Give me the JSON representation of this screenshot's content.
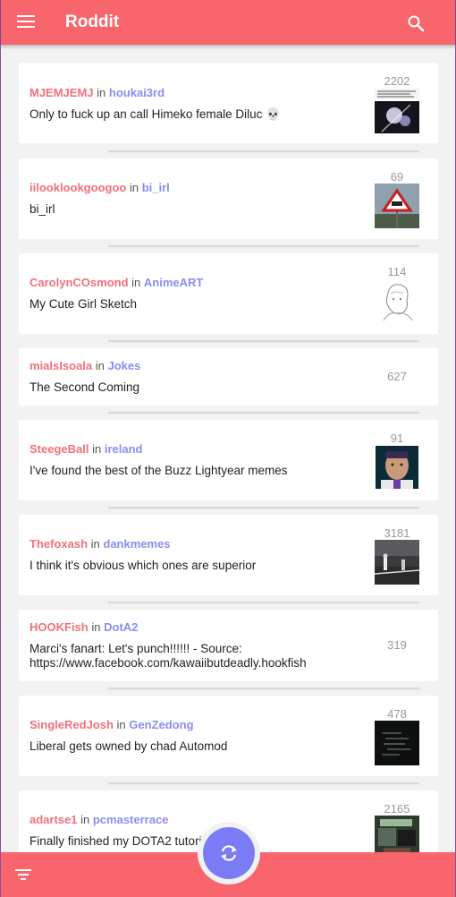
{
  "app": {
    "title": "Roddit",
    "menu_icon": "menu-icon",
    "search_icon": "search-icon",
    "filter_icon": "filter-icon",
    "refresh_icon": "refresh-icon",
    "accent": "#f8656d",
    "fab_color": "#7b7cf5",
    "author_color": "#f2707a",
    "subreddit_color": "#8a8cf2"
  },
  "posts": [
    {
      "author": "MJEMJEMJ",
      "in": "in",
      "subreddit": "houkai3rd",
      "title": "Only to fuck up an call Himeko female Diluc 💀",
      "score": "2202",
      "thumb": "meme"
    },
    {
      "author": "iilooklookgoogoo",
      "in": "in",
      "subreddit": "bi_irl",
      "title": "bi_irl",
      "score": "69",
      "thumb": "road-sign"
    },
    {
      "author": "CarolynCOsmond",
      "in": "in",
      "subreddit": "AnimeART",
      "title": "My Cute Girl Sketch",
      "score": "114",
      "thumb": "sketch"
    },
    {
      "author": "mialsIsoala",
      "in": "in",
      "subreddit": "Jokes",
      "title": "The Second Coming",
      "score": "627",
      "thumb": ""
    },
    {
      "author": "SteegeBall",
      "in": "in",
      "subreddit": "ireland",
      "title": "I've found the best of the Buzz Lightyear memes",
      "score": "91",
      "thumb": "buzz"
    },
    {
      "author": "Thefoxash",
      "in": "in",
      "subreddit": "dankmemes",
      "title": "I think it's obvious which ones are superior",
      "score": "3181",
      "thumb": "street"
    },
    {
      "author": "HOOKFish",
      "in": "in",
      "subreddit": "DotA2",
      "title": "Marci's fanart: Let's punch!!!!!! - Source: https://www.facebook.com/kawaiibutdeadly.hookfish",
      "score": "319",
      "thumb": ""
    },
    {
      "author": "SingleRedJosh",
      "in": "in",
      "subreddit": "GenZedong",
      "title": "Liberal gets owned by chad Automod",
      "score": "478",
      "thumb": "dark"
    },
    {
      "author": "adartse1",
      "in": "in",
      "subreddit": "pcmasterrace",
      "title": "Finally finished my DOTA2 tutorial",
      "score": "2165",
      "thumb": "pc"
    }
  ]
}
